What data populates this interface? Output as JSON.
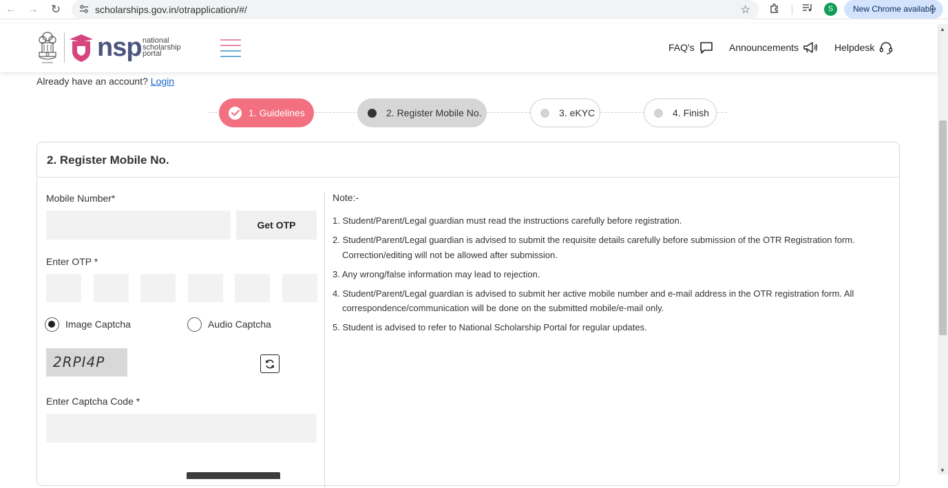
{
  "browser": {
    "url": "scholarships.gov.in/otrapplication/#/",
    "profile_initial": "S",
    "update_label": "New Chrome available"
  },
  "header": {
    "logo_text": "nsp",
    "logo_sub_1": "national",
    "logo_sub_2": "scholarship",
    "logo_sub_3": "portal",
    "faq": "FAQ's",
    "announcements": "Announcements",
    "helpdesk": "Helpdesk"
  },
  "account": {
    "prompt": "Already have an account?",
    "login": "Login"
  },
  "steps": [
    {
      "label": "1. Guidelines",
      "state": "done"
    },
    {
      "label": "2. Register Mobile No.",
      "state": "active"
    },
    {
      "label": "3. eKYC",
      "state": "pending"
    },
    {
      "label": "4. Finish",
      "state": "pending"
    }
  ],
  "form": {
    "title": "2. Register Mobile No.",
    "mobile_label": "Mobile Number*",
    "mobile_value": "",
    "get_otp": "Get OTP",
    "otp_label": "Enter OTP *",
    "image_captcha": "Image Captcha",
    "audio_captcha": "Audio Captcha",
    "captcha_text": "2RPI4P",
    "captcha_code_label": "Enter Captcha Code *",
    "captcha_code_value": ""
  },
  "notes": {
    "title": "Note:-",
    "items": [
      "1. Student/Parent/Legal guardian must read the instructions carefully before registration.",
      "2. Student/Parent/Legal guardian is advised to submit the requisite details carefully before submission of the OTR Registration form. Correction/editing will not be allowed after submission.",
      "3. Any wrong/false information may lead to rejection.",
      "4. Student/Parent/Legal guardian is advised to submit her active mobile number and e-mail address in the OTR registration form. All correspondence/communication will be done on the submitted mobile/e-mail only.",
      "5. Student is advised to refer to National Scholarship Portal for regular updates."
    ]
  },
  "colors": {
    "step_done": "#f2707f",
    "step_active": "#d6d6d6",
    "brand": "#4b5580",
    "logo_accent": "#d6457e"
  }
}
